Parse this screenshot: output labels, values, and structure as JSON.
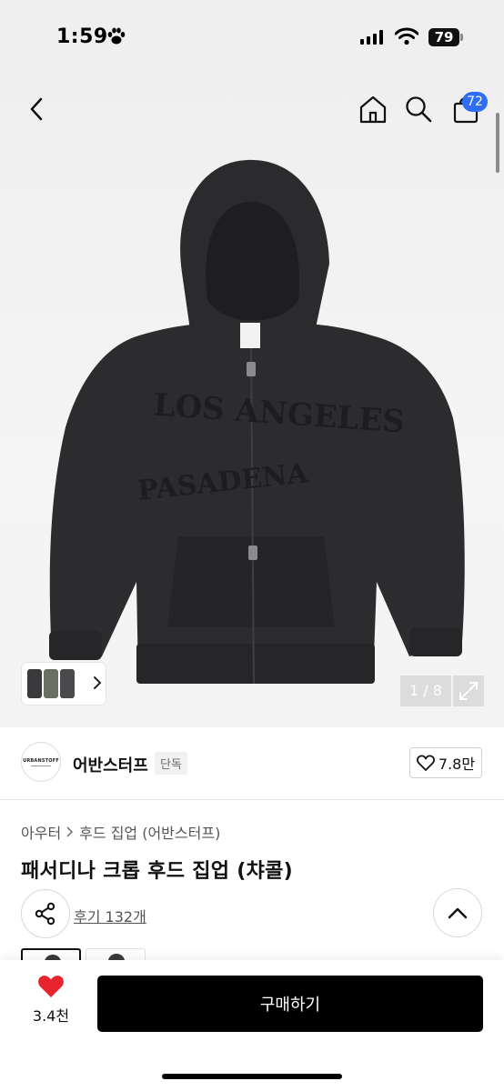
{
  "status_bar": {
    "time": "1:59",
    "battery": "79"
  },
  "nav": {
    "cart_count": "72"
  },
  "gallery": {
    "counter": "1 / 8",
    "hoodie_print_top": "LOS ANGELES",
    "hoodie_print_bottom": "PASADENA"
  },
  "brand": {
    "name": "어반스터프",
    "tag": "단독",
    "likes": "7.8만",
    "logo_text": "URBANSTOFF"
  },
  "product": {
    "breadcrumb": [
      "아우터",
      "후드 집업 (어반스터프)"
    ],
    "title": "패서디나 크롭 후드 집업 (챠콜)",
    "reviews": "후기 132개"
  },
  "bottom_bar": {
    "like_count": "3.4천",
    "buy_label": "구매하기"
  },
  "colors": {
    "accent_blue": "#2f6df6",
    "heart_red": "#e8242f",
    "hoodie_charcoal": "#2c2c2e"
  }
}
